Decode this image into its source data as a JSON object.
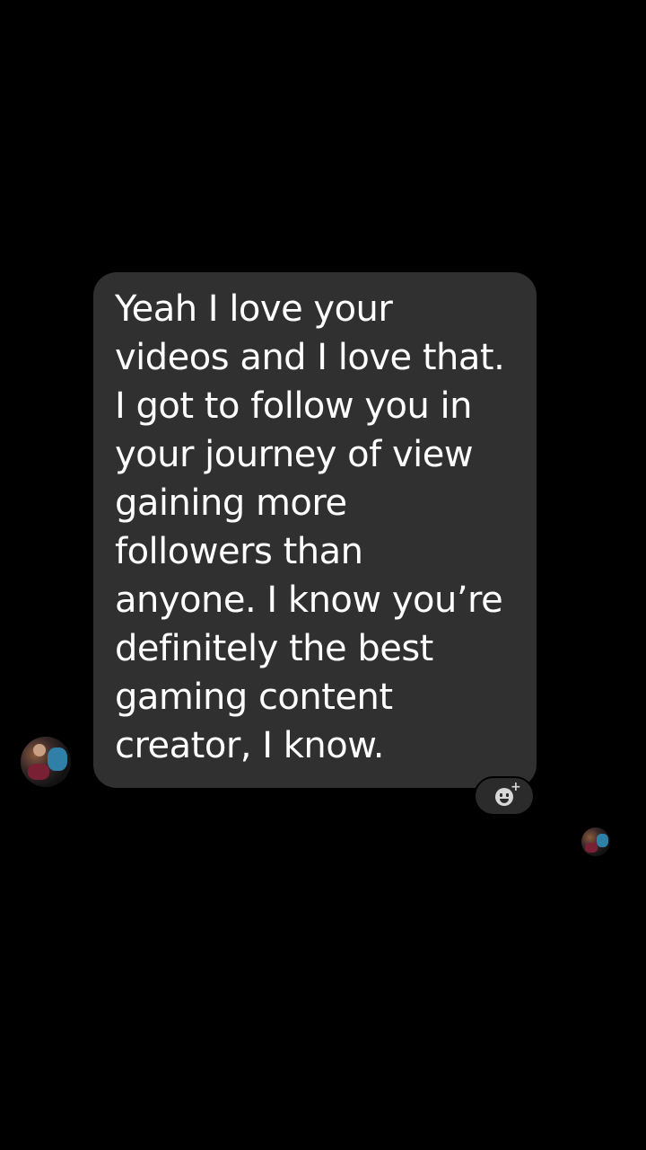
{
  "message": {
    "text": "Yeah I love your\nvideos and I love that.\nI got to follow you in\nyour journey of view\ngaining more\nfollowers than\nanyone. I know you’re\ndefinitely the best\ngaming content\ncreator, I know.",
    "bubble_color": "#303030",
    "text_color": "#ffffff"
  },
  "reaction": {
    "icon": "add-reaction-icon"
  },
  "avatars": {
    "sender_icon": "avatar-icon",
    "seen_icon": "seen-avatar-icon"
  },
  "background_color": "#000000"
}
